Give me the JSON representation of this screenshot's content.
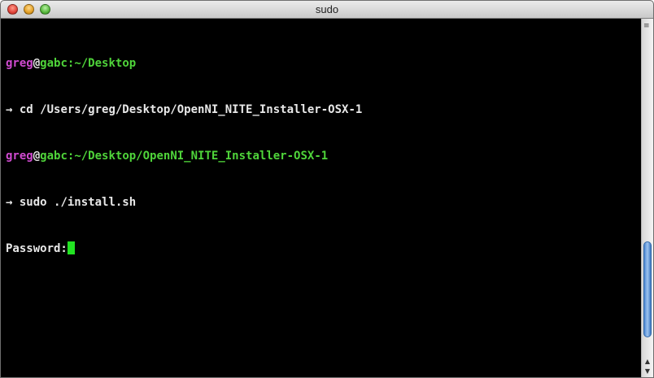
{
  "window": {
    "title": "sudo"
  },
  "terminal": {
    "lines": [
      {
        "user": "greg",
        "at": "@",
        "host": "gabc",
        "sep": ":",
        "path": "~/Desktop"
      },
      {
        "arrow": "→",
        "command": " cd /Users/greg/Desktop/OpenNI_NITE_Installer-OSX-1"
      },
      {
        "user": "greg",
        "at": "@",
        "host": "gabc",
        "sep": ":",
        "path": "~/Desktop/OpenNI_NITE_Installer-OSX-1"
      },
      {
        "arrow": "→",
        "command": " sudo ./install.sh"
      },
      {
        "prompt": "Password:"
      }
    ]
  },
  "colors": {
    "user": "#d04ad0",
    "host": "#4fd43a",
    "cursor": "#22e322",
    "background": "#000000"
  },
  "icons": {
    "close": "close-icon",
    "minimize": "minimize-icon",
    "zoom": "zoom-icon",
    "scroll_up": "scroll-up-icon",
    "scroll_down": "scroll-down-icon"
  }
}
